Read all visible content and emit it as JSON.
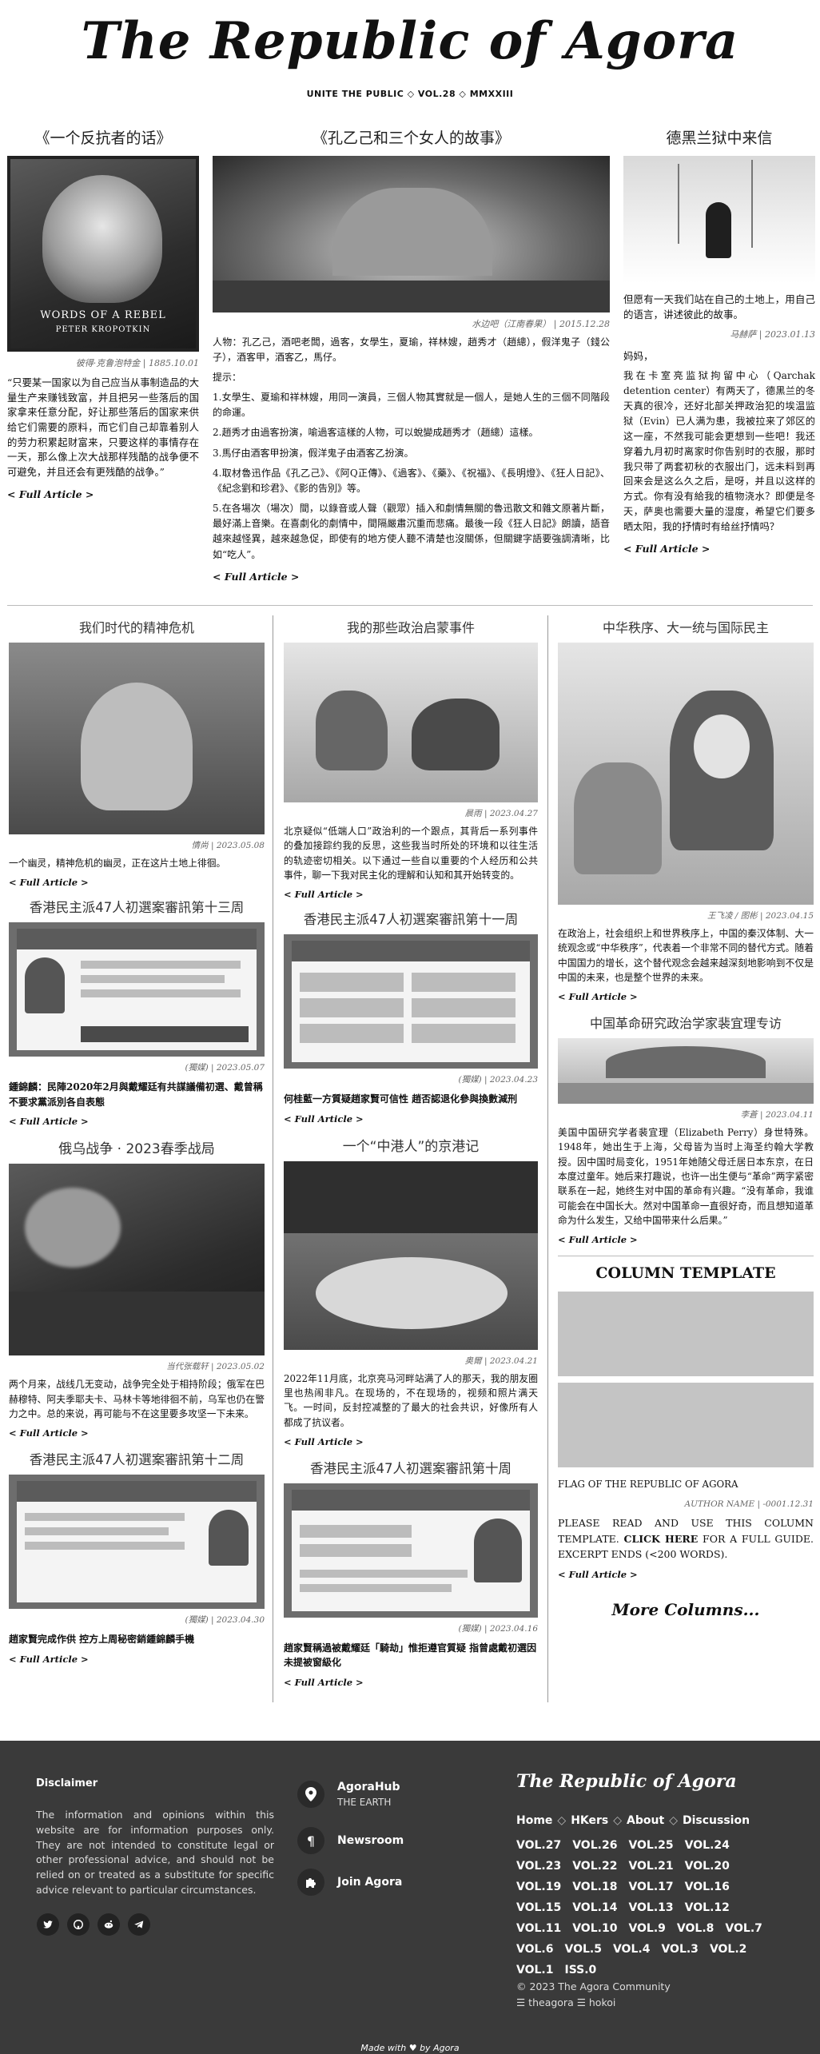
{
  "masthead": {
    "title": "The Republic of Agora",
    "subtitle": "UNITE THE PUBLIC ◇ VOL.28 ◇ MMXXIII"
  },
  "top": {
    "left": {
      "title": "《一个反抗者的话》",
      "image_icon": "book-cover-image",
      "image_text": "WORDS OF A REBEL\nPETER KROPOTKIN",
      "caption": "彼得·克鲁泡特金 | 1885.10.01",
      "body": "“只要某一国家以为自己应当从事制造品的大量生产来赚钱致富，并且把另一些落后的国家拿来任意分配，好让那些落后的国家来供给它们需要的原料，而它们自己却靠着别人的劳力积累起财富来，只要这样的事情存在一天，那么像上次大战那样残酷的战争便不可避免，并且还会有更残酷的战争。”",
      "more": "< Full Article >"
    },
    "center": {
      "title": "《孔乙己和三个女人的故事》",
      "caption": "水边吧（江南春果） | 2015.12.28",
      "cast": "人物：孔乙己，酒吧老闆，過客，女學生，夏瑜，祥林嫂，趙秀才（趙總），假洋鬼子（錢公子），酒客甲，酒客乙，馬仔。",
      "tip_label": "提示：",
      "tips": [
        "1.女學生、夏瑜和祥林嫂，用同一演員，三個人物其實就是一個人，是她人生的三個不同階段的命運。",
        "2.趙秀才由過客扮演，喻過客這樣的人物，可以蛻變成趙秀才（趙總）這樣。",
        "3.馬仔由酒客甲扮演，假洋鬼子由酒客乙扮演。",
        "4.取材魯迅作品《孔乙己》、《阿Q正傳》、《過客》、《藥》、《祝福》、《長明燈》、《狂人日記》、《紀念劉和珍君》、《影的告別》等。",
        "5.在各場次（場次）間，以錄音或人聲（觀眾）插入和劇情無關的魯迅散文和雜文原著片斷，最好滿上音樂。在喜劇化的劇情中，間隔嚴肅沉重而悲痛。最後一段《狂人日記》朗讀，語音越來越怪異，越來越急促，即使有的地方使人聽不清楚也沒關係，但關鍵字語要強調清晰，比如“吃人”。"
      ],
      "more": "< Full Article >"
    },
    "right": {
      "title": "德黑兰狱中来信",
      "intro": "但愿有一天我们站在自己的土地上，用自己的语言，讲述彼此的故事。",
      "caption": "马赫萨 | 2023.01.13",
      "greeting": "妈妈，",
      "body": "我在卡室亮监狱拘留中心（Qarchak detention center）有两天了，德黑兰的冬天真的很冷，还好北部关押政治犯的埃温监狱（Evin）已人满为患，我被拉来了郊区的这一座，不然我可能会更想到一些吧！我还穿着九月初时离家时你告别时的衣服，那时我只带了两套初秋的衣服出门，远未料到再回来会是这么久之后，是呀，并且以这样的方式。你有没有給我的植物浇水？即便是冬天，萨奥也需要大量的湿度，希望它们要多晒太阳，我的抒情时有给丝抒情吗？",
      "more": "< Full Article >"
    }
  },
  "grid": {
    "c1": [
      {
        "title": "我们时代的精神危机",
        "caption": "情尚 | 2023.05.08",
        "body": "一个幽灵，精神危机的幽灵，正在这片土地上徘徊。",
        "more": "< Full Article >"
      },
      {
        "title": "香港民主派47人初選案審訊第十三周",
        "caption": "(獨媒) | 2023.05.07",
        "body": "鍾錦麟：民陣2020年2月與戴耀廷有共謀議備初選、戴曾稱不要求黨派別各自表態",
        "more": "< Full Article >"
      },
      {
        "title": "俄乌战争 · 2023春季战局",
        "caption": "当代张载轩 | 2023.05.02",
        "body": "两个月来，战线几无变动，战争完全处于相持阶段；俄军在巴赫穆特、阿夫季耶夫卡、马林卡等地徘徊不前，乌军也仍在警力之中。总的来说，再可能与不在这里要多攻坚一下未来。",
        "more": "< Full Article >"
      },
      {
        "title": "香港民主派47人初選案審訊第十二周",
        "caption": "(獨媒) | 2023.04.30",
        "body": "趙家賢完成作供 控方上周秘密銷鍾錦麟手機",
        "more": "< Full Article >"
      }
    ],
    "c2": [
      {
        "title": "我的那些政治启蒙事件",
        "caption": "晨雨 | 2023.04.27",
        "body": "北京疑似“低端人口”政治利的一个跟点，其背后一系列事件的叠加接踪约我的反思，这些我当时所处的环境和以往生活的轨迹密切相关。以下通过一些自以重要的个人经历和公共事件，聊一下我对民主化的理解和认知和其开始转变的。",
        "more": "< Full Article >"
      },
      {
        "title": "香港民主派47人初選案審訊第十一周",
        "caption": "(獨媒) | 2023.04.23",
        "body": "何桂藍一方質疑趙家賢可信性 趙否認退化參與換數減刑",
        "more": "< Full Article >"
      },
      {
        "title": "一个“中港人”的京港记",
        "caption": "奥爾 | 2023.04.21",
        "body": "2022年11月底，北京亮马河畔站满了人的那天，我的朋友圈里也热闹非凡。在现场的，不在现场的，视频和照片满天飞。一时间，反封控减整的了最大的社会共识，好像所有人都成了抗议者。",
        "more": "< Full Article >"
      },
      {
        "title": "香港民主派47人初選案審訊第十周",
        "caption": "(獨媒) | 2023.04.16",
        "body": "趙家賢稱過被戴耀廷「騎劫」惟拒遵官質疑 指曾處戴初選因未提被窗級化",
        "more": "< Full Article >"
      }
    ],
    "c3": [
      {
        "title": "中华秩序、大一统与国际民主",
        "caption": "王飞凌 / 图彬 | 2023.04.15",
        "body": "在政治上，社会组织上和世界秩序上，中国的秦汉体制、大一统观念或“中华秩序”，代表着一个非常不同的替代方式。随着中国国力的增长，这个替代观念会越来越深刻地影响到不仅是中国的未来，也是整个世界的未来。",
        "more": "< Full Article >"
      },
      {
        "title": "中国革命研究政治学家裴宜理专访",
        "caption": "李蒼 | 2023.04.11",
        "body": "美国中国研究学者裴宜理（Elizabeth Perry）身世特殊。1948年，她出生于上海，父母皆为当时上海圣约翰大学教授。因中国时局变化，1951年她随父母迁居日本东京，在日本度过童年。她后来打趣说，也许一出生便与“革命”两字紧密联系在一起，她终生对中国的革命有兴趣。“没有革命，我谁可能会在中国长大。然对中国革命一直很好奇，而且想知道革命为什么发生，又给中国带来什么后果。”",
        "more": "< Full Article >"
      },
      {
        "title": "COLUMN TEMPLATE",
        "flag_label": "FLAG OF THE REPUBLIC OF AGORA",
        "caption": "AUTHOR NAME | -0001.12.31",
        "body_pre": "PLEASE READ AND USE THIS COLUMN TEMPLATE. ",
        "body_link": "CLICK HERE",
        "body_post": " FOR A FULL GUIDE. EXCERPT ENDS (<200 WORDS).",
        "more": "< Full Article >"
      }
    ]
  },
  "more_columns": "More Columns...",
  "footer": {
    "disclaimer_title": "Disclaimer",
    "disclaimer": "The information and opinions within this website are for information purposes only. They are not intended to constitute legal or other professional advice, and should not be relied on or treated as a substitute for specific advice relevant to particular circumstances.",
    "social": [
      "twitter-icon",
      "github-icon",
      "reddit-icon",
      "telegram-icon"
    ],
    "links": [
      {
        "icon": "location-pin-icon",
        "title": "AgoraHub",
        "sub": "THE EARTH"
      },
      {
        "icon": "pilcrow-icon",
        "title": "Newsroom",
        "sub": ""
      },
      {
        "icon": "puzzle-icon",
        "title": "Join Agora",
        "sub": ""
      }
    ],
    "brand": "The Republic of Agora",
    "nav": [
      "Home",
      "HKers",
      "About",
      "Discussion"
    ],
    "vols": [
      "VOL.27",
      "VOL.26",
      "VOL.25",
      "VOL.24",
      "VOL.23",
      "VOL.22",
      "VOL.21",
      "VOL.20",
      "VOL.19",
      "VOL.18",
      "VOL.17",
      "VOL.16",
      "VOL.15",
      "VOL.14",
      "VOL.13",
      "VOL.12",
      "VOL.11",
      "VOL.10",
      "VOL.9",
      "VOL.8",
      "VOL.7",
      "VOL.6",
      "VOL.5",
      "VOL.4",
      "VOL.3",
      "VOL.2",
      "VOL.1",
      "ISS.0"
    ],
    "copyright": "© 2023 The Agora Community",
    "credits": "☰ theagora ☰ hokoi",
    "made_with": "Made with ♥ by Agora"
  }
}
